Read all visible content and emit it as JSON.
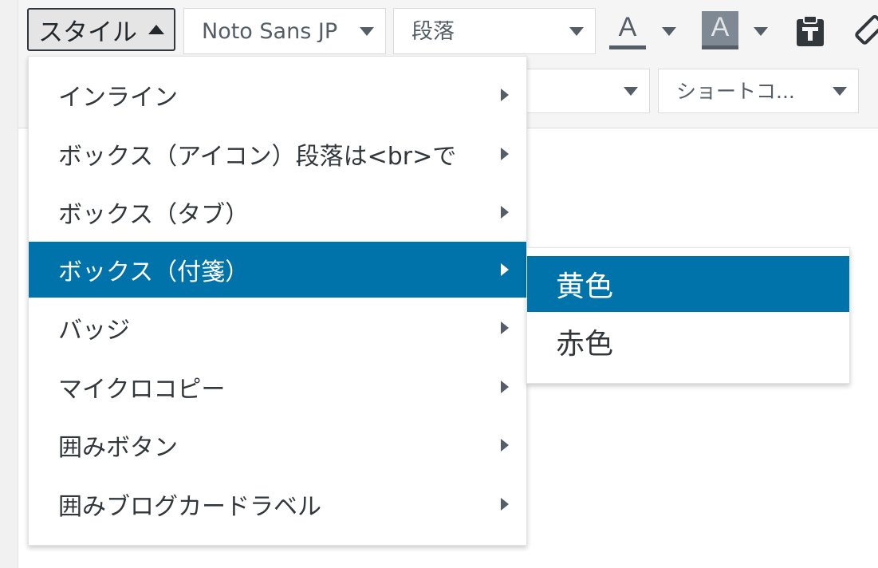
{
  "toolbar": {
    "style_button": {
      "label": "スタイル"
    },
    "font_select": {
      "value": "Noto Sans JP"
    },
    "format_select": {
      "value": "段落"
    },
    "text_color": {
      "glyph": "A"
    },
    "background_color": {
      "glyph": "A"
    },
    "shortcode_select": {
      "value": "ショートコ..."
    }
  },
  "style_menu": {
    "items": [
      {
        "label": "インライン"
      },
      {
        "label": "ボックス（アイコン）段落は<br>で"
      },
      {
        "label": "ボックス（タブ）"
      },
      {
        "label": "ボックス（付箋）"
      },
      {
        "label": "バッジ"
      },
      {
        "label": "マイクロコピー"
      },
      {
        "label": "囲みボタン"
      },
      {
        "label": "囲みブログカードラベル"
      }
    ],
    "active_index": 3
  },
  "submenu": {
    "items": [
      {
        "label": "黄色"
      },
      {
        "label": "赤色"
      }
    ],
    "active_index": 0
  },
  "colors": {
    "accent": "#0073aa",
    "toolbar_bg": "#f5f5f5",
    "text": "#32373c"
  }
}
